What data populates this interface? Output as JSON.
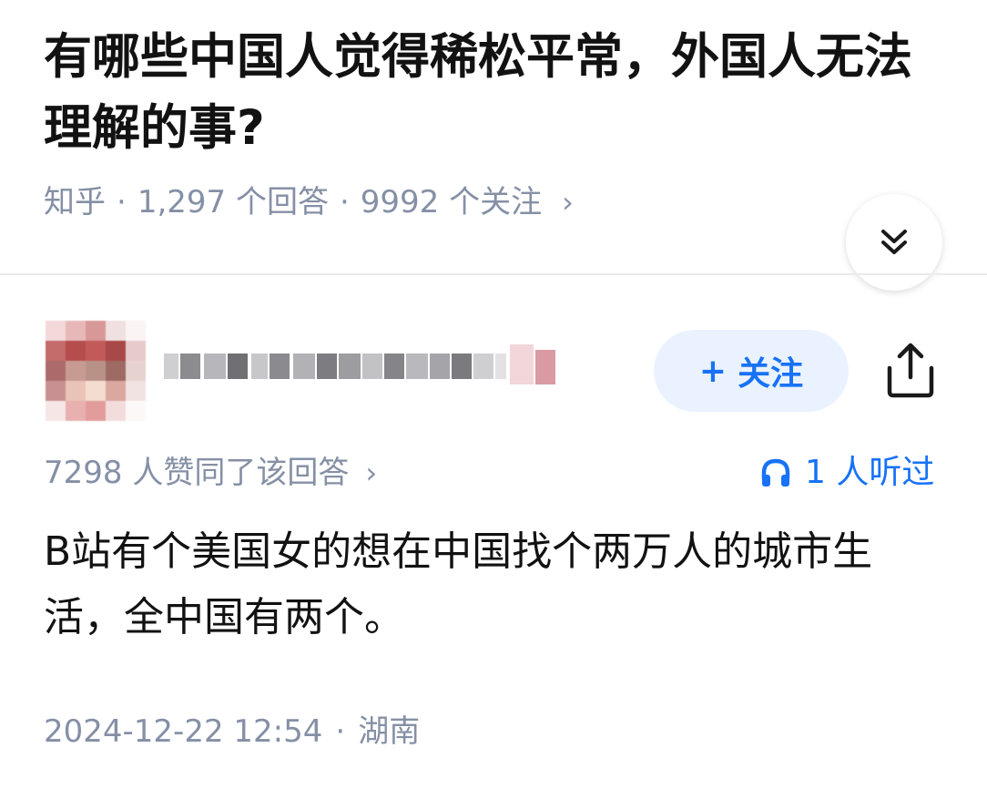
{
  "question": {
    "title": "有哪些中国人觉得稀松平常，外国人无法理解的事?",
    "source": "知乎",
    "answers": "1,297 个回答",
    "followers": "9992 个关注",
    "separator": "·",
    "chevron": "›"
  },
  "collapse": {
    "icon": "double-chevron-down-icon"
  },
  "author": {
    "avatar": "blurred-avatar",
    "name": "blurred-name"
  },
  "follow_button": {
    "plus": "+",
    "label": "关注"
  },
  "share": {
    "icon": "share-icon"
  },
  "answer": {
    "votes": "7298 人赞同了该回答",
    "chevron": "›",
    "listened_icon": "headphones-icon",
    "listened": "1 人听过",
    "content": "B站有个美国女的想在中国找个两万人的城市生活，全中国有两个。",
    "date": "2024-12-22 12:54",
    "separator": "·",
    "location": "湖南"
  },
  "colors": {
    "accent": "#1772f6",
    "muted_text": "#8590a6",
    "follow_bg": "#ebf2ff"
  }
}
